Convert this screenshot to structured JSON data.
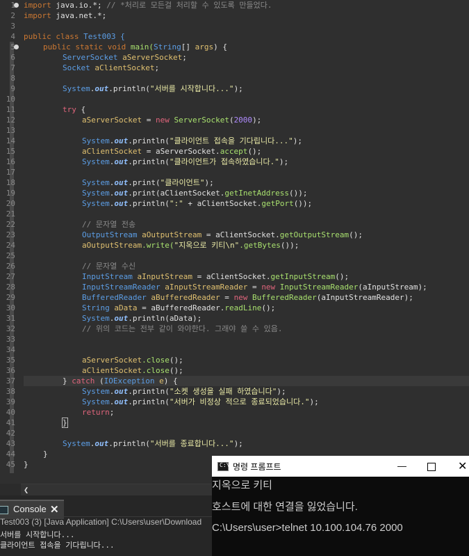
{
  "editor": {
    "line_numbers": [
      "1",
      "2",
      "3",
      "4",
      "5",
      "6",
      "7",
      "8",
      "9",
      "10",
      "11",
      "12",
      "13",
      "14",
      "15",
      "16",
      "17",
      "18",
      "19",
      "20",
      "21",
      "22",
      "23",
      "24",
      "25",
      "26",
      "27",
      "28",
      "29",
      "30",
      "31",
      "32",
      "33",
      "34",
      "35",
      "36",
      "37",
      "38",
      "39",
      "40",
      "41",
      "42",
      "43",
      "44",
      "45"
    ],
    "code": {
      "l1_kw": "import",
      "l1_rest": " java.io.*; ",
      "l1_comment": "// *처리로 모든걸 처리할 수 있도록 만들었다.",
      "l2_kw": "import",
      "l2_rest": " java.net.*;",
      "l4_kw": "public class",
      "l4_name": " Test003 {",
      "l5_kw": "public static void",
      "l5_method": " main(",
      "l5_type": "String",
      "l5_rest": "[] ",
      "l5_arg": "args",
      "l5_end": ") {",
      "l6_type": "ServerSocket",
      "l6_var": " aServerSocket",
      "l6_end": ";",
      "l7_type": "Socket",
      "l7_var": " aClientSocket",
      "l7_end": ";",
      "sys": "System",
      "dot": ".",
      "out": "out",
      "println": ".println(",
      "print": ".print(",
      "l9_str": "\"서버를 시작합니다...\"",
      "close_semi": ");",
      "l11_kw": "try",
      "l11_end": " {",
      "l12_var": "aServerSocket",
      "l12_mid": " = ",
      "l12_new": "new",
      "l12_type": " ServerSocket",
      "l12_open": "(",
      "l12_num": "2000",
      "l12_close": ");",
      "l14_str": "\"클라이언트 접속을 기다립니다...\"",
      "l15_var": "aClientSocket",
      "l15_mid": " = aServerSocket.",
      "l15_m": "accept",
      "l15_end": "();",
      "l16_str": "\"클라이언트가 접속하였습니다.\"",
      "l18_str": "\"클라이언트\"",
      "l19_rest": "aClientSocket.",
      "l19_m": "getInetAddress",
      "l19_end": "());",
      "l20_str": "\":\"",
      "l20_mid": " + aClientSocket.",
      "l20_m": "getPort",
      "l20_end": "());",
      "l22_comment": "// 문자열 전송",
      "l23_type": "OutputStream",
      "l23_var": " aOutputStream",
      "l23_mid": " = aClientSocket.",
      "l23_m": "getOutputStream",
      "l23_end": "();",
      "l24_var": "aOutputStream",
      "l24_m": ".write(",
      "l24_str": "\"지옥으로 키티\\n\"",
      "l24_m2": ".getBytes",
      "l24_end": "());",
      "l26_comment": "// 문자열 수신",
      "l27_type": "InputStream",
      "l27_var": " aInputStream",
      "l27_mid": " = aClientSocket.",
      "l27_m": "getInputStream",
      "l27_end": "();",
      "l28_type": "InputStreamReader",
      "l28_var": " aInputStreamReader",
      "l28_mid": " = ",
      "l28_new": "new",
      "l28_type2": " InputStreamReader",
      "l28_end": "(aInputStream);",
      "l29_type": "BufferedReader",
      "l29_var": " aBufferedReader",
      "l29_mid": " = ",
      "l29_new": "new",
      "l29_type2": " BufferedReader",
      "l29_end": "(aInputStreamReader);",
      "l30_type": "String",
      "l30_var": " aData",
      "l30_mid": " = aBufferedReader.",
      "l30_m": "readLine",
      "l30_end": "();",
      "l31_arg": "aData",
      "l32_comment": "// 위의 코드는 전부 같이 와야한다. 그래야 쓸 수 있음.",
      "l35_var": "aServerSocket",
      "l35_m": ".close",
      "l35_end": "();",
      "l36_var": "aClientSocket",
      "l36_m": ".close",
      "l36_end": "();",
      "l37_a": "} ",
      "l37_kw": "catch",
      "l37_b": " (",
      "l37_type": "IOException",
      "l37_var": " e",
      "l37_c": ") {",
      "l38_str": "\"소켓 생성을 실패 하였습니다\"",
      "l39_str": "\"서버가 비정상 적으로 종료되었습니다.\"",
      "l40_kw": "return",
      "l40_end": ";",
      "l41": "}",
      "l43_str": "\"서버를 종료합니다...\"",
      "l44": "}",
      "l45": "}"
    }
  },
  "console": {
    "tab_label": "Console",
    "status": "Test003 (3) [Java Application] C:\\Users\\user\\Download",
    "output": [
      "서버를 시작합니다...",
      "클라이언트 접속을 기다립니다..."
    ]
  },
  "cmd": {
    "title": "명령 프롬프트",
    "lines": [
      "지옥으로 키티",
      "호스트에 대한 연결을 잃었습니다.",
      "C:\\Users\\user>telnet 10.100.104.76 2000"
    ]
  },
  "colors": {
    "editor_bg": "#2f2f2f",
    "keyword": "#cc7832",
    "type": "#5c9ee6",
    "string": "#e9e9a6",
    "comment": "#8a8a8a",
    "cmd_bg": "#0c0c0c"
  },
  "icons": [
    "fold-marker-icon",
    "console-icon",
    "close-icon",
    "cmd-icon",
    "minimize-icon",
    "maximize-icon",
    "scroll-left-icon"
  ]
}
